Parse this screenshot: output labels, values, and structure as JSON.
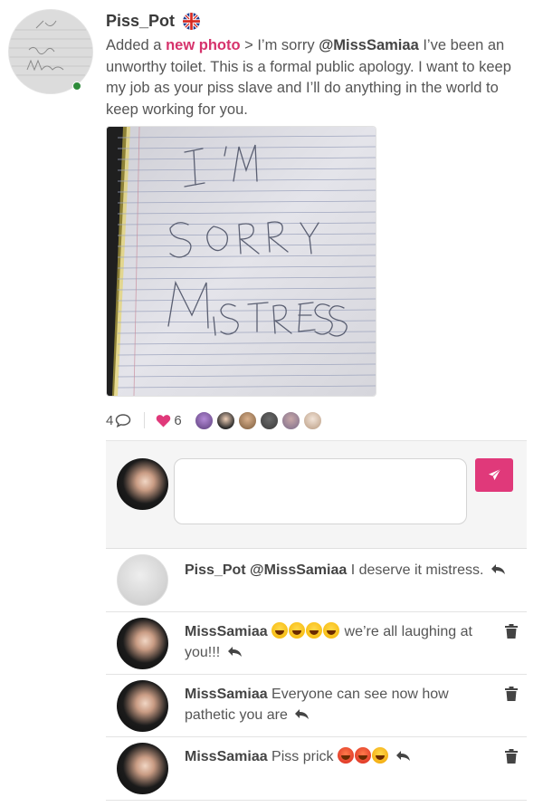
{
  "post": {
    "author": "Piss_Pot",
    "flag": "uk-flag-icon",
    "prefix": "Added a ",
    "link": "new photo",
    "separator": " > I’m sorry ",
    "mention": "@MissSamiaa",
    "body": " I’ve been an unworthy toilet. This is a formal public apology. I want to keep my job as your piss slave and I’ll do anything in the world to keep working for you.",
    "photo_text": [
      "I'M",
      "SORRY",
      "MISTRESS"
    ],
    "comments_count": "4",
    "likes_count": "6",
    "colors": {
      "accent": "#e0397a",
      "link": "#d6336c",
      "online": "#2e8b3a"
    }
  },
  "composer": {
    "input_value": "",
    "send_icon": "paper-plane-icon"
  },
  "comments": [
    {
      "author": "Piss_Pot",
      "mention": "@MissSamiaa",
      "text": " I deserve it mistress.",
      "deletable": false
    },
    {
      "author": "MissSamiaa",
      "emoji_a": "face-with-tears-of-joy x1, rolling-on-floor-laughing x3",
      "text": " we’re all laughing at you!!!",
      "deletable": true
    },
    {
      "author": "MissSamiaa",
      "text": " Everyone can see now how pathetic you are",
      "deletable": true
    },
    {
      "author": "MissSamiaa",
      "text": " Piss prick",
      "emoji_b": "vomiting, pouting, angry",
      "deletable": true
    }
  ]
}
